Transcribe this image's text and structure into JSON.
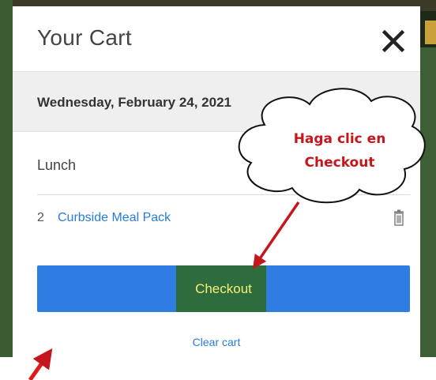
{
  "cart": {
    "title": "Your Cart",
    "date": "Wednesday, February 24, 2021",
    "meal": "Lunch",
    "items": [
      {
        "quantity": "2",
        "name": "Curbside Meal Pack"
      }
    ],
    "checkout_label": "Checkout",
    "clear_label": "Clear cart"
  },
  "annotation": {
    "line1": "Haga clic en",
    "line2": "Checkout"
  },
  "icons": {
    "close": "close-icon",
    "trash": "trash-icon"
  },
  "colors": {
    "primary_button": "#2f7de3",
    "link": "#2a7ad8",
    "highlight": "#2e6d3b",
    "annotation_red": "#c4161c"
  }
}
